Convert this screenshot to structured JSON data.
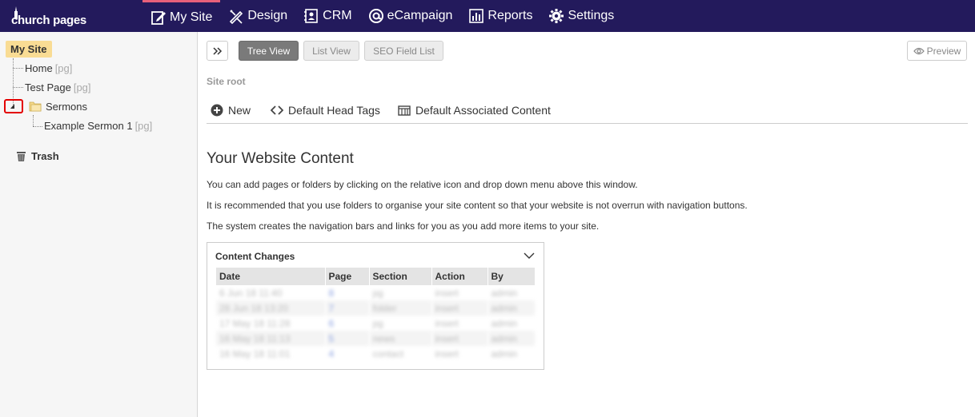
{
  "app": {
    "logo_text": "church pages"
  },
  "nav": {
    "items": [
      {
        "label": "My Site",
        "icon": "edit-icon",
        "active": true
      },
      {
        "label": "Design",
        "icon": "pencil-ruler-icon",
        "active": false
      },
      {
        "label": "CRM",
        "icon": "contacts-book-icon",
        "active": false
      },
      {
        "label": "eCampaign",
        "icon": "at-sign-icon",
        "active": false
      },
      {
        "label": "Reports",
        "icon": "bar-chart-icon",
        "active": false
      },
      {
        "label": "Settings",
        "icon": "gear-icon",
        "active": false
      }
    ]
  },
  "sidebar": {
    "root_label": "My Site",
    "items": [
      {
        "label": "Home",
        "tag": "[pg]"
      },
      {
        "label": "Test Page",
        "tag": "[pg]"
      },
      {
        "label": "Sermons",
        "tag": ""
      },
      {
        "label": "Example Sermon 1",
        "tag": "[pg]"
      }
    ],
    "trash_label": "Trash"
  },
  "toolbar": {
    "tabs": [
      "Tree View",
      "List View",
      "SEO Field List"
    ],
    "preview_label": "Preview"
  },
  "breadcrumb": "Site root",
  "actions": {
    "new": "New",
    "head_tags": "Default Head Tags",
    "associated": "Default Associated Content"
  },
  "content": {
    "title": "Your Website Content",
    "paragraphs": [
      "You can add pages or folders by clicking on the relative icon and drop down menu above this window.",
      "It is recommended that you use folders to organise your site content so that your website is not overrun with navigation buttons.",
      "The system creates the navigation bars and links for you as you add more items to your site."
    ]
  },
  "content_changes": {
    "title": "Content Changes",
    "columns": [
      "Date",
      "Page",
      "Section",
      "Action",
      "By"
    ],
    "rows": [
      [
        "6 Jun 18 11:40",
        "8",
        "pg",
        "insert",
        "admin"
      ],
      [
        "28 Jun 18 13:20",
        "7",
        "folder",
        "insert",
        "admin"
      ],
      [
        "17 May 18 11:28",
        "6",
        "pg",
        "insert",
        "admin"
      ],
      [
        "16 May 18 11:13",
        "5",
        "news",
        "insert",
        "admin"
      ],
      [
        "16 May 18 11:01",
        "4",
        "contact",
        "insert",
        "admin"
      ]
    ]
  }
}
